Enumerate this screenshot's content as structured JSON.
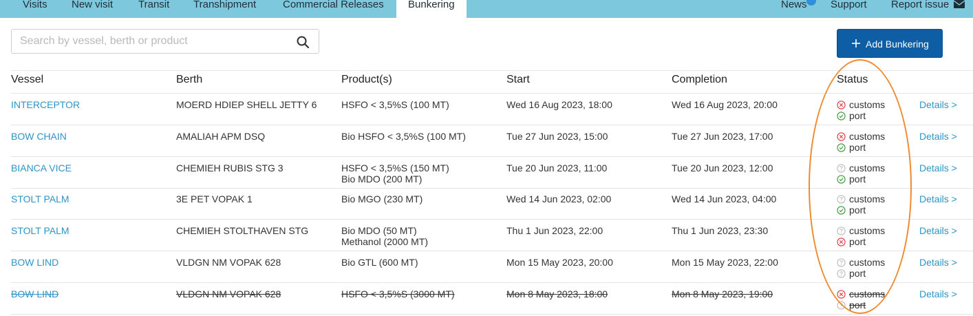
{
  "nav": {
    "tabs": [
      {
        "label": "Visits"
      },
      {
        "label": "New visit"
      },
      {
        "label": "Transit"
      },
      {
        "label": "Transhipment"
      },
      {
        "label": "Commercial Releases"
      },
      {
        "label": "Bunkering",
        "active": true
      }
    ],
    "right": {
      "news": "News",
      "support": "Support",
      "report": "Report issue"
    }
  },
  "search": {
    "placeholder": "Search by vessel, berth or product",
    "value": ""
  },
  "add_button": {
    "label": "Add Bunkering"
  },
  "table": {
    "headers": {
      "vessel": "Vessel",
      "berth": "Berth",
      "products": "Product(s)",
      "start": "Start",
      "completion": "Completion",
      "status": "Status"
    },
    "details_label": "Details >",
    "status_labels": {
      "customs": "customs",
      "port": "port"
    },
    "rows": [
      {
        "vessel": "INTERCEPTOR",
        "berth": "MOERD HDIEP SHELL JETTY 6",
        "product1": "HSFO < 3,5%S (100 MT)",
        "product2": "",
        "start": "Wed 16 Aug 2023, 18:00",
        "completion": "Wed 16 Aug 2023, 20:00",
        "customs": "rejected",
        "port": "approved",
        "cancelled": false
      },
      {
        "vessel": "BOW CHAIN",
        "berth": "AMALIAH APM DSQ",
        "product1": "Bio HSFO < 3,5%S (100 MT)",
        "product2": "",
        "start": "Tue 27 Jun 2023, 15:00",
        "completion": "Tue 27 Jun 2023, 17:00",
        "customs": "rejected",
        "port": "approved",
        "cancelled": false
      },
      {
        "vessel": "BIANCA VICE",
        "berth": "CHEMIEH RUBIS STG 3",
        "product1": "HSFO < 3,5%S (150 MT)",
        "product2": "Bio MDO (200 MT)",
        "start": "Tue 20 Jun 2023, 11:00",
        "completion": "Tue 20 Jun 2023, 12:00",
        "customs": "pending",
        "port": "approved",
        "cancelled": false
      },
      {
        "vessel": "STOLT PALM",
        "berth": "3E PET VOPAK 1",
        "product1": "Bio MGO (230 MT)",
        "product2": "",
        "start": "Wed 14 Jun 2023, 02:00",
        "completion": "Wed 14 Jun 2023, 04:00",
        "customs": "pending",
        "port": "approved",
        "cancelled": false
      },
      {
        "vessel": "STOLT PALM",
        "berth": "CHEMIEH STOLTHAVEN STG",
        "product1": "Bio MDO (50 MT)",
        "product2": "Methanol (2000 MT)",
        "start": "Thu 1 Jun 2023, 22:00",
        "completion": "Thu 1 Jun 2023, 23:30",
        "customs": "pending",
        "port": "rejected",
        "cancelled": false
      },
      {
        "vessel": "BOW LIND",
        "berth": "VLDGN NM VOPAK 628",
        "product1": "Bio GTL (600 MT)",
        "product2": "",
        "start": "Mon 15 May 2023, 20:00",
        "completion": "Mon 15 May 2023, 22:00",
        "customs": "pending",
        "port": "pending",
        "cancelled": false
      },
      {
        "vessel": "BOW LIND",
        "berth": "VLDGN NM VOPAK 628",
        "product1": "HSFO < 3,5%S (3000 MT)",
        "product2": "",
        "start": "Mon 8 May 2023, 18:00",
        "completion": "Mon 8 May 2023, 19:00",
        "customs": "rejected",
        "port": "pending",
        "cancelled": true
      }
    ]
  },
  "colors": {
    "nav_bg": "#7ec8dd",
    "link": "#2e95c6",
    "button": "#0d5ea5",
    "rejected": "#e0393e",
    "approved": "#3a9a3a",
    "pending": "#bdbdbd",
    "annotation": "#f08a30"
  },
  "icons": {
    "rejected": "x-circle-icon",
    "approved": "check-circle-icon",
    "pending": "question-circle-icon"
  }
}
